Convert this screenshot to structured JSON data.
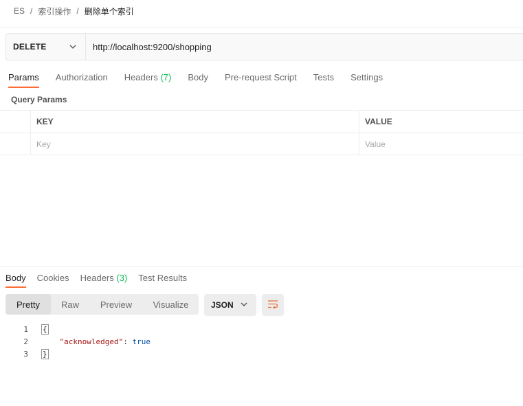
{
  "breadcrumb": [
    "ES",
    "索引操作",
    "删除单个索引"
  ],
  "request": {
    "method": "DELETE",
    "url": "http://localhost:9200/shopping"
  },
  "request_tabs": [
    {
      "label": "Params",
      "count": ""
    },
    {
      "label": "Authorization",
      "count": ""
    },
    {
      "label": "Headers",
      "count": "(7)"
    },
    {
      "label": "Body",
      "count": ""
    },
    {
      "label": "Pre-request Script",
      "count": ""
    },
    {
      "label": "Tests",
      "count": ""
    },
    {
      "label": "Settings",
      "count": ""
    }
  ],
  "params": {
    "section_title": "Query Params",
    "key_header": "KEY",
    "value_header": "VALUE",
    "key_placeholder": "Key",
    "value_placeholder": "Value"
  },
  "response_tabs": [
    {
      "label": "Body",
      "count": ""
    },
    {
      "label": "Cookies",
      "count": ""
    },
    {
      "label": "Headers",
      "count": "(3)"
    },
    {
      "label": "Test Results",
      "count": ""
    }
  ],
  "view_modes": [
    "Pretty",
    "Raw",
    "Preview",
    "Visualize"
  ],
  "format": "JSON",
  "code": {
    "line_numbers": [
      "1",
      "2",
      "3"
    ],
    "open_brace": "{",
    "key": "\"acknowledged\"",
    "colon": ": ",
    "value": "true",
    "close_brace": "}"
  },
  "colors": {
    "accent": "#ff6c37",
    "count_green": "#0cbb52",
    "json_key": "#a31515",
    "json_bool": "#0451a5"
  },
  "icons": [
    "chevron-down-icon",
    "wrap-lines-icon"
  ]
}
